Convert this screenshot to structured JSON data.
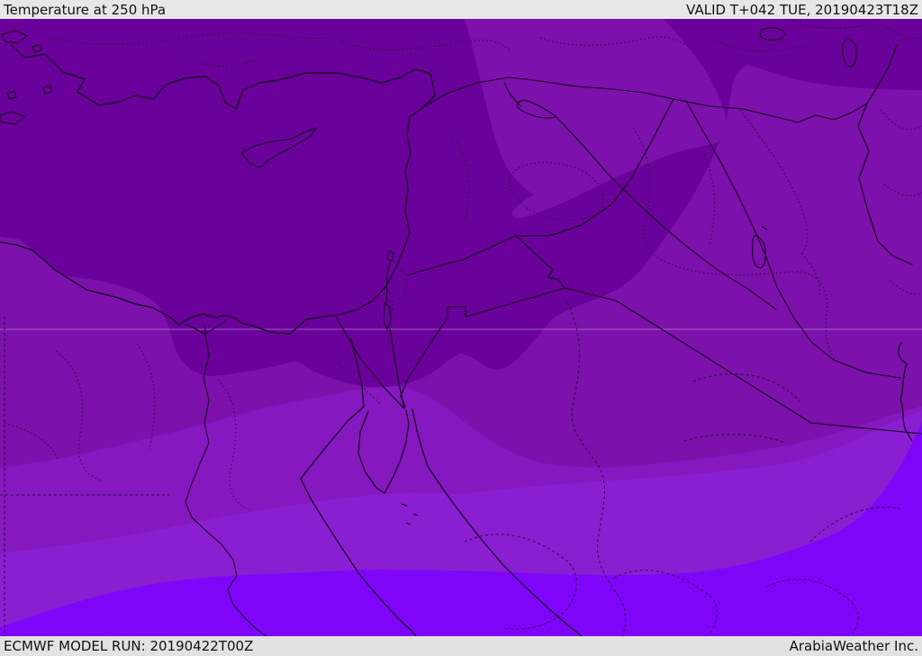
{
  "header": {
    "title": "Temperature at 250 hPa",
    "valid": "VALID T+042 TUE, 20190423T18Z"
  },
  "footer": {
    "model_run": "ECMWF MODEL RUN: 20190422T00Z",
    "company": "ArabiaWeather Inc."
  },
  "map": {
    "parameter": "Temperature at 250 hPa",
    "model": "ECMWF",
    "region": "Middle East / Eastern Mediterranean",
    "palette": {
      "band_coldest": "#6a019a",
      "band_cold": "#7c11ab",
      "band_mild": "#8518bf",
      "band_warm": "#8a1fd2",
      "band_warmest": "#7f05f9",
      "line": "#10001a",
      "bar_background": "#e7e7e7",
      "text": "#111111"
    },
    "bands_order_cold_to_warm": [
      "band_coldest",
      "band_cold",
      "band_mild",
      "band_warm",
      "band_warmest"
    ]
  }
}
